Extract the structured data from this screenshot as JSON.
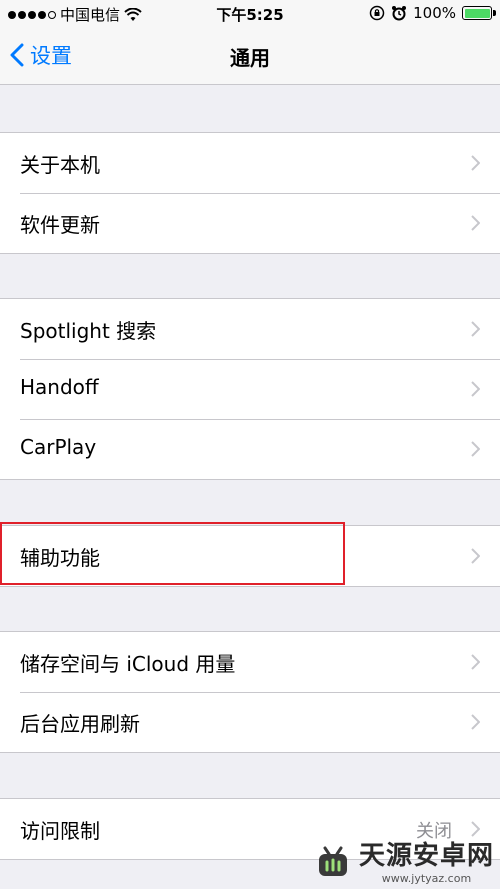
{
  "status_bar": {
    "carrier": "中国电信",
    "time": "下午5:25",
    "battery": "100%",
    "battery_color": "#4cd964"
  },
  "nav": {
    "back_label": "设置",
    "title": "通用",
    "accent": "#007aff"
  },
  "groups": [
    {
      "items": [
        {
          "label": "关于本机"
        },
        {
          "label": "软件更新"
        }
      ]
    },
    {
      "items": [
        {
          "label": "Spotlight 搜索"
        },
        {
          "label": "Handoff"
        },
        {
          "label": "CarPlay"
        }
      ]
    },
    {
      "items": [
        {
          "label": "辅助功能",
          "highlighted": true
        }
      ]
    },
    {
      "items": [
        {
          "label": "储存空间与 iCloud 用量"
        },
        {
          "label": "后台应用刷新"
        }
      ]
    },
    {
      "items": [
        {
          "label": "访问限制",
          "value": "关闭"
        }
      ]
    }
  ],
  "watermark": {
    "name": "天源安卓网",
    "url": "www.jytyaz.com"
  }
}
